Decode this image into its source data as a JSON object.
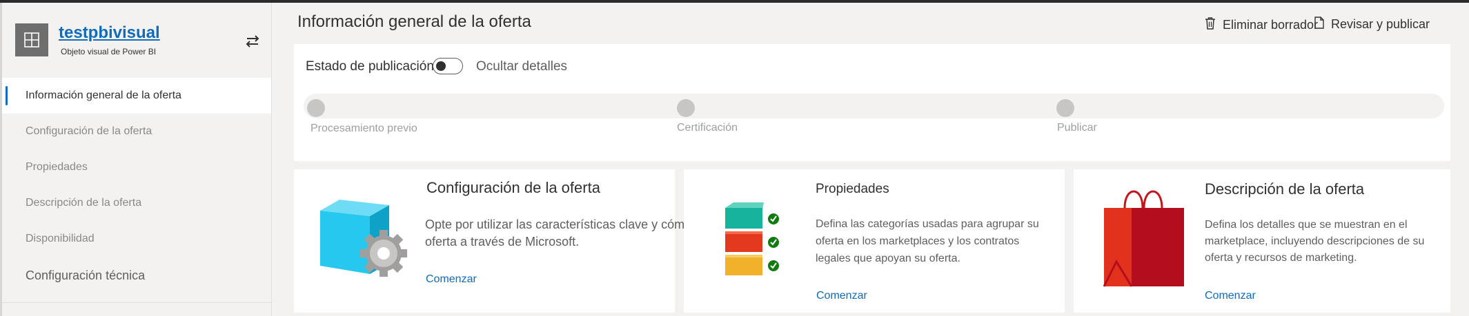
{
  "sidebar": {
    "app_name": "testpbivisual",
    "app_subtitle": "Objeto visual de Power BI",
    "items": [
      {
        "label": "Información general de la oferta"
      },
      {
        "label": "Configuración de la oferta"
      },
      {
        "label": "Propiedades"
      },
      {
        "label": "Descripción de la oferta"
      },
      {
        "label": "Disponibilidad"
      },
      {
        "label": "Configuración técnica"
      }
    ]
  },
  "header": {
    "title": "Información general de la oferta",
    "delete_label": "Eliminar borrador",
    "publish_label": "Revisar y publicar"
  },
  "status": {
    "label": "Estado de publicación",
    "toggle_label": "Ocultar detalles",
    "toggle_on": false,
    "steps": [
      {
        "label": "Procesamiento previo"
      },
      {
        "label": "Certificación"
      },
      {
        "label": "Publicar"
      }
    ]
  },
  "cards": [
    {
      "title": "Configuración de la oferta",
      "description": "Opte por utilizar las características clave y cómo vender su oferta a través de Microsoft.",
      "link": "Comenzar",
      "icon": "cube-gear-icon"
    },
    {
      "title": "Propiedades",
      "description": "Defina las categorías usadas para agrupar su oferta en los marketplaces y los contratos legales que apoyan su oferta.",
      "link": "Comenzar",
      "icon": "stacked-blocks-check-icon"
    },
    {
      "title": "Descripción de la oferta",
      "description": "Defina los detalles que se muestran en el marketplace, incluyendo descripciones de su oferta y recursos de marketing.",
      "link": "Comenzar",
      "icon": "shopping-bag-icon"
    }
  ],
  "colors": {
    "accent": "#0f6cbd",
    "link": "#0f6cbd",
    "step_dot": "#c8c6c4"
  }
}
